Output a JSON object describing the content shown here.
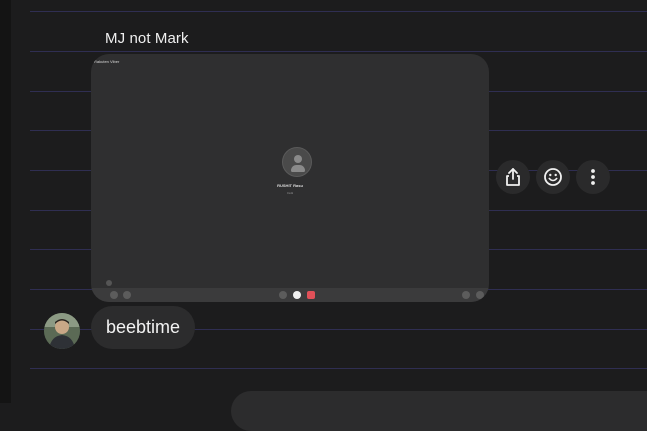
{
  "conversation": {
    "sender_name": "MJ not Mark",
    "message_text": "beebtime"
  },
  "attachment": {
    "app_title": "Rakuten Viber",
    "caller_name": "RUSHIT Rasu",
    "call_status": "Inviti"
  },
  "actions": {
    "icons": [
      "share-icon",
      "emoji-react-icon",
      "more-options-icon"
    ]
  },
  "colors": {
    "background": "#1c1c1d",
    "ruled_line": "#2f2e52",
    "bubble": "#2c2c2d",
    "end_call": "#e05058"
  }
}
